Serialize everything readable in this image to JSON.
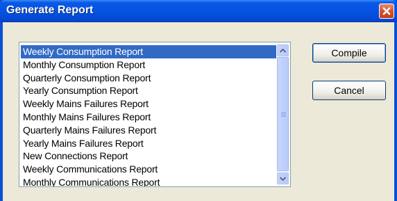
{
  "window": {
    "title": "Generate Report",
    "close_icon": "close-x-icon"
  },
  "report_list": {
    "selected_index": 0,
    "items": [
      "Weekly Consumption Report",
      "Monthly Consumption Report",
      "Quarterly Consumption Report",
      "Yearly Consumption Report",
      "Weekly Mains Failures Report",
      "Monthly Mains Failures Report",
      "Quarterly Mains Failures Report",
      "Yearly Mains Failures Report",
      "New Connections Report",
      "Weekly Communications Report",
      "Monthly Communications Report"
    ],
    "scroll_position": 0
  },
  "buttons": {
    "compile_label": "Compile",
    "cancel_label": "Cancel"
  },
  "colors": {
    "titlebar": "#0553e3",
    "selection": "#316ac5",
    "dialog_face": "#ece9d8",
    "close_button": "#d4502c"
  }
}
